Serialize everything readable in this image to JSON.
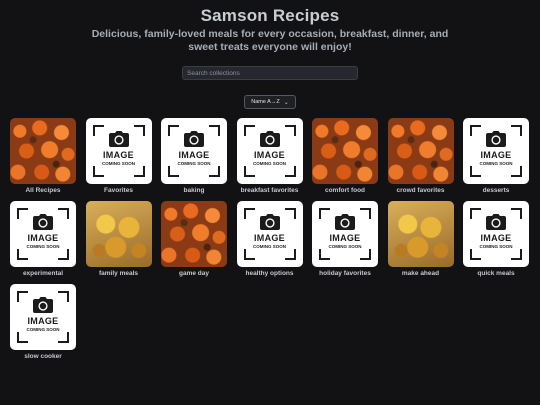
{
  "header": {
    "title": "Samson Recipes",
    "subtitle": "Delicious, family-loved meals for every occasion, breakfast, dinner, and sweet treats everyone will enjoy!"
  },
  "search": {
    "placeholder": "Search collections",
    "value": ""
  },
  "sort": {
    "selected": "Name A→Z"
  },
  "placeholder_image": {
    "big_text": "IMAGE",
    "small_text": "COMING SOON",
    "icon": "camera-icon"
  },
  "collections": [
    {
      "label": "All Recipes",
      "image": "chicken"
    },
    {
      "label": "Favorites",
      "image": "placeholder"
    },
    {
      "label": "baking",
      "image": "placeholder"
    },
    {
      "label": "breakfast favorites",
      "image": "placeholder"
    },
    {
      "label": "comfort food",
      "image": "chicken"
    },
    {
      "label": "crowd favorites",
      "image": "chicken"
    },
    {
      "label": "desserts",
      "image": "placeholder"
    },
    {
      "label": "experimental",
      "image": "placeholder"
    },
    {
      "label": "family meals",
      "image": "casserole"
    },
    {
      "label": "game day",
      "image": "chicken"
    },
    {
      "label": "healthy options",
      "image": "placeholder"
    },
    {
      "label": "holiday favorites",
      "image": "placeholder"
    },
    {
      "label": "make ahead",
      "image": "casserole"
    },
    {
      "label": "quick meals",
      "image": "placeholder"
    },
    {
      "label": "slow cooker",
      "image": "placeholder"
    }
  ]
}
